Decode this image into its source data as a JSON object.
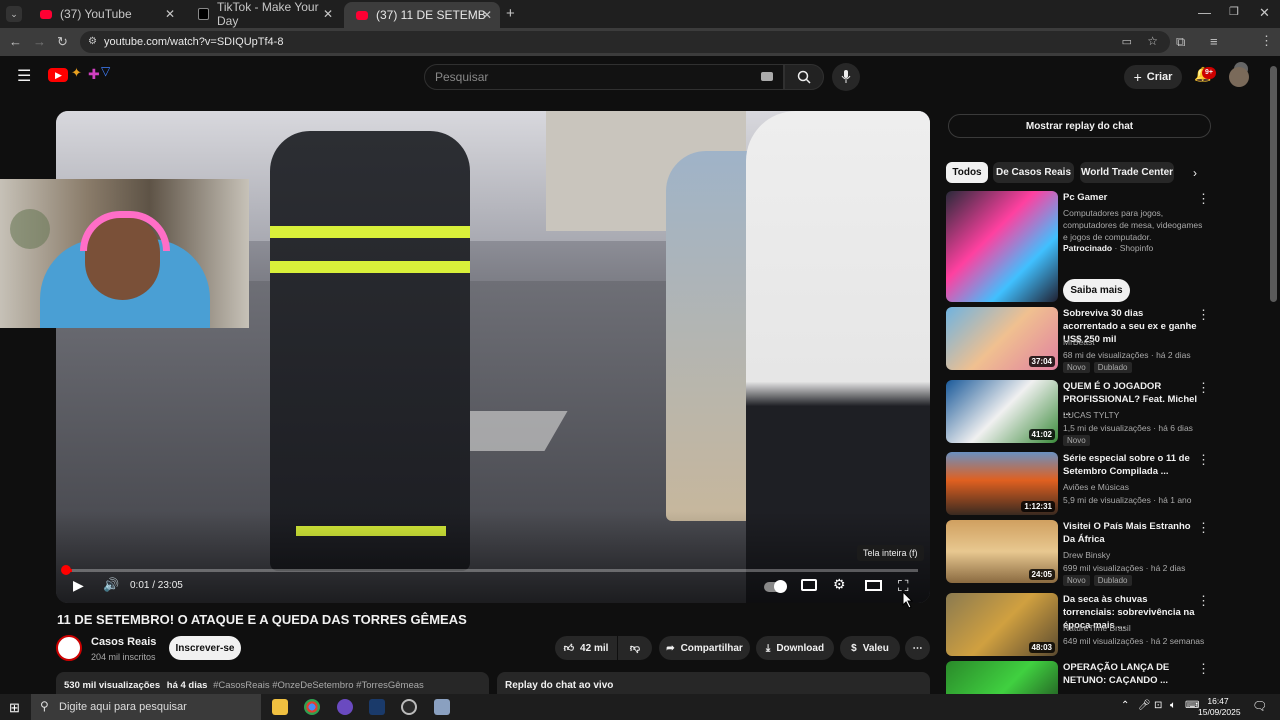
{
  "browser": {
    "tabs": [
      {
        "label": "(37) YouTube",
        "favicon": "youtube-icon"
      },
      {
        "label": "TikTok - Make Your Day",
        "favicon": "tiktok-icon"
      },
      {
        "label": "(37) 11 DE SETEMBRO! O ATAQ",
        "favicon": "youtube-icon"
      }
    ],
    "url": "youtube.com/watch?v=SDIQUpTf4-8"
  },
  "header": {
    "search_placeholder": "Pesquisar",
    "create_label": "Criar",
    "notifications_count": "9+"
  },
  "player": {
    "time_current": "0:01",
    "time_total": "23:05",
    "time_display": "0:01 / 23:05",
    "progress_fraction": 0.0007,
    "fullscreen_tooltip": "Tela inteira (f)"
  },
  "video": {
    "title": "11 DE SETEMBRO! O ATAQUE E A QUEDA DAS TORRES GÊMEAS",
    "channel_name": "Casos Reais",
    "subscribers": "204 mil inscritos",
    "subscribe_label": "Inscrever-se",
    "likes": "42 mil",
    "share_label": "Compartilhar",
    "download_label": "Download",
    "thanks_label": "Valeu",
    "views": "530 mil visualizações",
    "posted": "há 4 dias",
    "hashtags": "#CasosReais #OnzeDeSetembro #TorresGêmeas",
    "chat_replay_heading": "Replay do chat ao vivo"
  },
  "sidebar": {
    "show_chat_label": "Mostrar replay do chat",
    "chips": [
      "Todos",
      "De Casos Reais",
      "World Trade Center"
    ],
    "ad": {
      "title": "Pc Gamer",
      "description": "Computadores para jogos, computadores de mesa, videogames e jogos de computador.",
      "sponsored": "Patrocinado",
      "advertiser": "Shopinfo",
      "cta": "Saiba mais"
    },
    "recommendations": [
      {
        "title": "Sobreviva 30 dias acorrentado a seu ex e ganhe US$ 250 mil",
        "channel": "MrBeast",
        "meta": "68 mi de visualizações · há 2 dias",
        "duration": "37:04",
        "badges": [
          "Novo",
          "Dublado"
        ]
      },
      {
        "title": "QUEM É O JOGADOR PROFISSIONAL? Feat. Michel ...",
        "channel": "LUCAS TYLTY",
        "meta": "1,5 mi de visualizações · há 6 dias",
        "duration": "41:02",
        "badges": [
          "Novo"
        ]
      },
      {
        "title": "Série especial sobre o 11 de Setembro Compilada ...",
        "channel": "Aviões e Músicas",
        "meta": "5,9 mi de visualizações · há 1 ano",
        "duration": "1:12:31",
        "badges": []
      },
      {
        "title": "Visitei O País Mais Estranho Da África",
        "channel": "Drew Binsky",
        "meta": "699 mil visualizações · há 2 dias",
        "duration": "24:05",
        "badges": [
          "Novo",
          "Dublado"
        ]
      },
      {
        "title": "Da seca às chuvas torrenciais: sobrevivência na época mais ...",
        "channel": "NatureTime Brasil",
        "meta": "649 mil visualizações · há 2 semanas",
        "duration": "48:03",
        "badges": []
      },
      {
        "title": "OPERAÇÃO LANÇA DE NETUNO: CAÇANDO ...",
        "channel": "",
        "meta": "",
        "duration": "",
        "badges": []
      }
    ]
  },
  "taskbar": {
    "search_placeholder": "Digite aqui para pesquisar",
    "time": "16:47",
    "date": "15/09/2025"
  },
  "colors": {
    "accent_red": "#ff0000",
    "background": "#0f0f0f",
    "surface": "#272727"
  }
}
